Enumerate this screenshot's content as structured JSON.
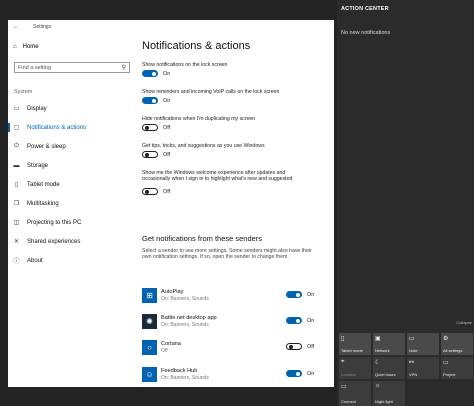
{
  "settings_window": {
    "title": "Settings",
    "back_glyph": "←"
  },
  "sidebar": {
    "home": "Home",
    "search_placeholder": "Find a setting",
    "section": "System",
    "items": [
      {
        "label": "Display",
        "icon": "display-icon"
      },
      {
        "label": "Notifications & actions",
        "icon": "notifications-icon",
        "active": true
      },
      {
        "label": "Power & sleep",
        "icon": "power-icon"
      },
      {
        "label": "Storage",
        "icon": "storage-icon"
      },
      {
        "label": "Tablet mode",
        "icon": "tablet-icon"
      },
      {
        "label": "Multitasking",
        "icon": "multitasking-icon"
      },
      {
        "label": "Projecting to this PC",
        "icon": "projecting-icon"
      },
      {
        "label": "Shared experiences",
        "icon": "shared-icon"
      },
      {
        "label": "About",
        "icon": "info-icon"
      }
    ]
  },
  "main": {
    "title": "Notifications & actions",
    "settings": [
      {
        "label": "Show notifications on the lock screen",
        "state": "On"
      },
      {
        "label": "Show reminders and incoming VoIP calls on the lock screen",
        "state": "On"
      },
      {
        "label": "Hide notifications when I'm duplicating my screen",
        "state": "Off"
      },
      {
        "label": "Get tips, tricks, and suggestions as you use Windows",
        "state": "Off"
      },
      {
        "label": "Show me the Windows welcome experience after updates and occasionally when I sign in to highlight what's new and suggested",
        "state": "Off"
      }
    ],
    "senders_heading": "Get notifications from these senders",
    "senders_desc": "Select a sender to see more settings. Some senders might also have their own notification settings. If so, open the sender to change them.",
    "senders": [
      {
        "name": "AutoPlay",
        "sub": "On: Banners, Sounds",
        "state": "On"
      },
      {
        "name": "Battle.net desktop app",
        "sub": "On: Banners, Sounds",
        "state": "On"
      },
      {
        "name": "Cortana",
        "sub": "Off",
        "state": "Off"
      },
      {
        "name": "Feedback Hub",
        "sub": "On: Banners, Sounds",
        "state": "On"
      }
    ]
  },
  "action_center": {
    "title": "ACTION CENTER",
    "empty": "No new notifications",
    "collapse": "Collapse",
    "tiles": [
      {
        "label": "Tablet mode"
      },
      {
        "label": "Network"
      },
      {
        "label": "Note"
      },
      {
        "label": "All settings"
      },
      {
        "label": "Location",
        "dim": true
      },
      {
        "label": "Quiet hours"
      },
      {
        "label": "VPN"
      },
      {
        "label": "Project"
      },
      {
        "label": "Connect"
      },
      {
        "label": "Night light"
      }
    ]
  },
  "colors": {
    "accent": "#0063b1",
    "action_center_bg": "#2b2b2b"
  }
}
